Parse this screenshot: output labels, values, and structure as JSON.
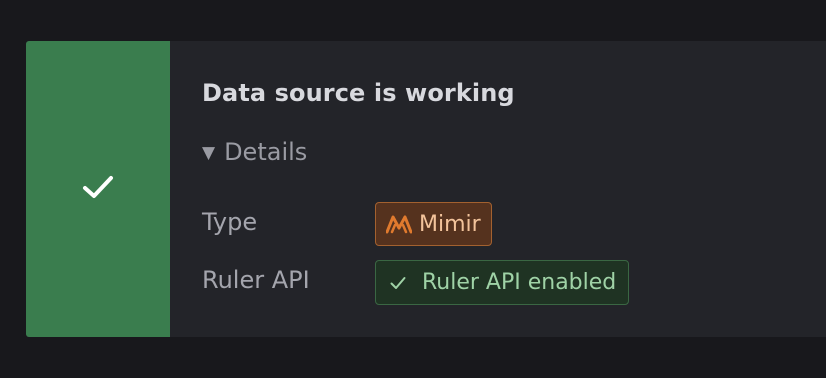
{
  "alert": {
    "title": "Data source is working",
    "status_color": "#3a7d4e",
    "status_icon": "check-icon"
  },
  "details": {
    "toggle_label": "Details",
    "toggle_icon": "triangle-down-icon",
    "type": {
      "label": "Type",
      "value": "Mimir",
      "icon": "mimir-logo-icon",
      "badge_color": "#a3612f"
    },
    "ruler_api": {
      "label": "Ruler API",
      "value": "Ruler API enabled",
      "icon": "check-icon",
      "badge_color": "#3a6743"
    }
  }
}
